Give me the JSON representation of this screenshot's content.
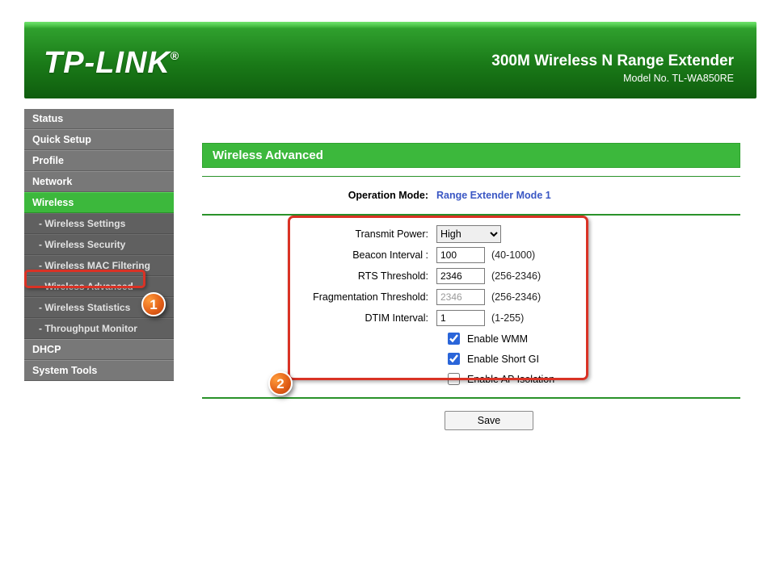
{
  "header": {
    "brand": "TP-LINK",
    "registered": "®",
    "product_line1": "300M Wireless N Range Extender",
    "product_line2": "Model No. TL-WA850RE"
  },
  "nav": {
    "items": [
      {
        "label": "Status",
        "kind": "item"
      },
      {
        "label": "Quick Setup",
        "kind": "item"
      },
      {
        "label": "Profile",
        "kind": "item"
      },
      {
        "label": "Network",
        "kind": "item"
      },
      {
        "label": "Wireless",
        "kind": "item",
        "active": true
      },
      {
        "label": "- Wireless Settings",
        "kind": "sub"
      },
      {
        "label": "- Wireless Security",
        "kind": "sub"
      },
      {
        "label": "- Wireless MAC Filtering",
        "kind": "sub"
      },
      {
        "label": "- Wireless Advanced",
        "kind": "sub",
        "highlighted": true
      },
      {
        "label": "- Wireless Statistics",
        "kind": "sub"
      },
      {
        "label": "- Throughput Monitor",
        "kind": "sub"
      },
      {
        "label": "DHCP",
        "kind": "item"
      },
      {
        "label": "System Tools",
        "kind": "item"
      }
    ]
  },
  "page": {
    "title": "Wireless Advanced",
    "mode_label": "Operation Mode:",
    "mode_value": "Range Extender Mode 1",
    "fields": {
      "transmit_power": {
        "label": "Transmit Power:",
        "value": "High"
      },
      "beacon_interval": {
        "label": "Beacon Interval :",
        "value": "100",
        "hint": "(40-1000)"
      },
      "rts_threshold": {
        "label": "RTS Threshold:",
        "value": "2346",
        "hint": "(256-2346)"
      },
      "frag_threshold": {
        "label": "Fragmentation Threshold:",
        "value": "2346",
        "hint": "(256-2346)"
      },
      "dtim_interval": {
        "label": "DTIM Interval:",
        "value": "1",
        "hint": "(1-255)"
      },
      "enable_wmm": {
        "label": "Enable WMM",
        "checked": true
      },
      "enable_short_gi": {
        "label": "Enable Short GI",
        "checked": true
      },
      "enable_ap_isolation": {
        "label": "Enable AP Isolation",
        "checked": false
      }
    },
    "save_label": "Save"
  },
  "annotations": {
    "callout1": "1",
    "callout2": "2"
  }
}
